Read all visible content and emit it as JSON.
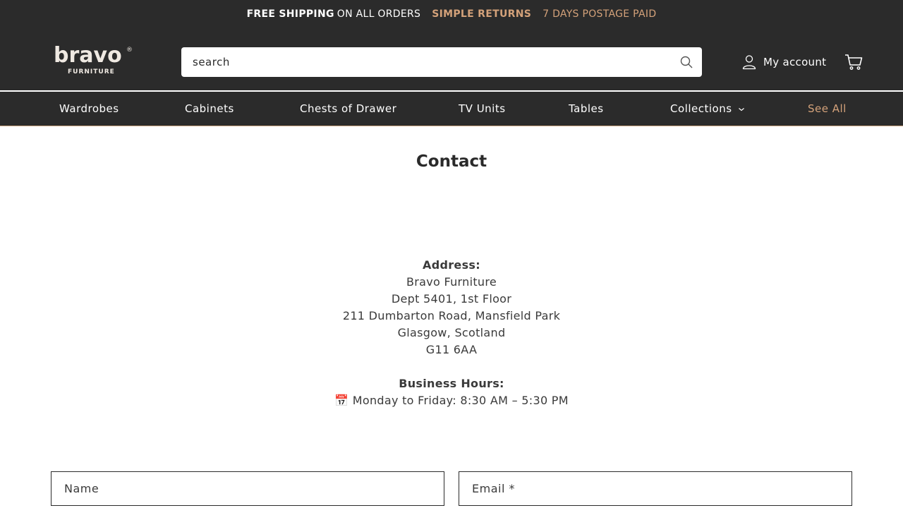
{
  "announcement": {
    "part1": "FREE SHIPPING",
    "part2": "ON ALL ORDERS",
    "part3": "SIMPLE RETURNS",
    "part4": "7 DAYS POSTAGE PAID"
  },
  "logo": {
    "wordmark": "bravo",
    "subtitle": "FURNITURE",
    "mark": "®"
  },
  "search": {
    "placeholder": "search",
    "icon": "search-icon"
  },
  "account": {
    "label": "My account",
    "icon": "user-icon"
  },
  "cart": {
    "icon": "cart-icon"
  },
  "nav": {
    "items": [
      {
        "label": "Wardrobes"
      },
      {
        "label": "Cabinets"
      },
      {
        "label": "Chests of Drawer"
      },
      {
        "label": "TV Units"
      },
      {
        "label": "Tables"
      },
      {
        "label": "Collections",
        "icon": "chevron-down-icon"
      },
      {
        "label": "See All"
      }
    ]
  },
  "page": {
    "title": "Contact"
  },
  "address": {
    "label": "Address:",
    "lines": [
      "Bravo Furniture",
      "Dept 5401, 1st Floor",
      "211 Dumbarton Road, Mansfield Park",
      "Glasgow, Scotland",
      "G11 6AA"
    ]
  },
  "hours": {
    "label": "Business Hours:",
    "emoji": "📅",
    "text": "Monday to Friday: 8:30 AM – 5:30 PM"
  },
  "form": {
    "name_placeholder": "Name",
    "email_placeholder": "Email *"
  },
  "colors": {
    "header_bg": "#2b2b2b",
    "accent": "#d4a27a",
    "text": "#2a2a2a"
  }
}
